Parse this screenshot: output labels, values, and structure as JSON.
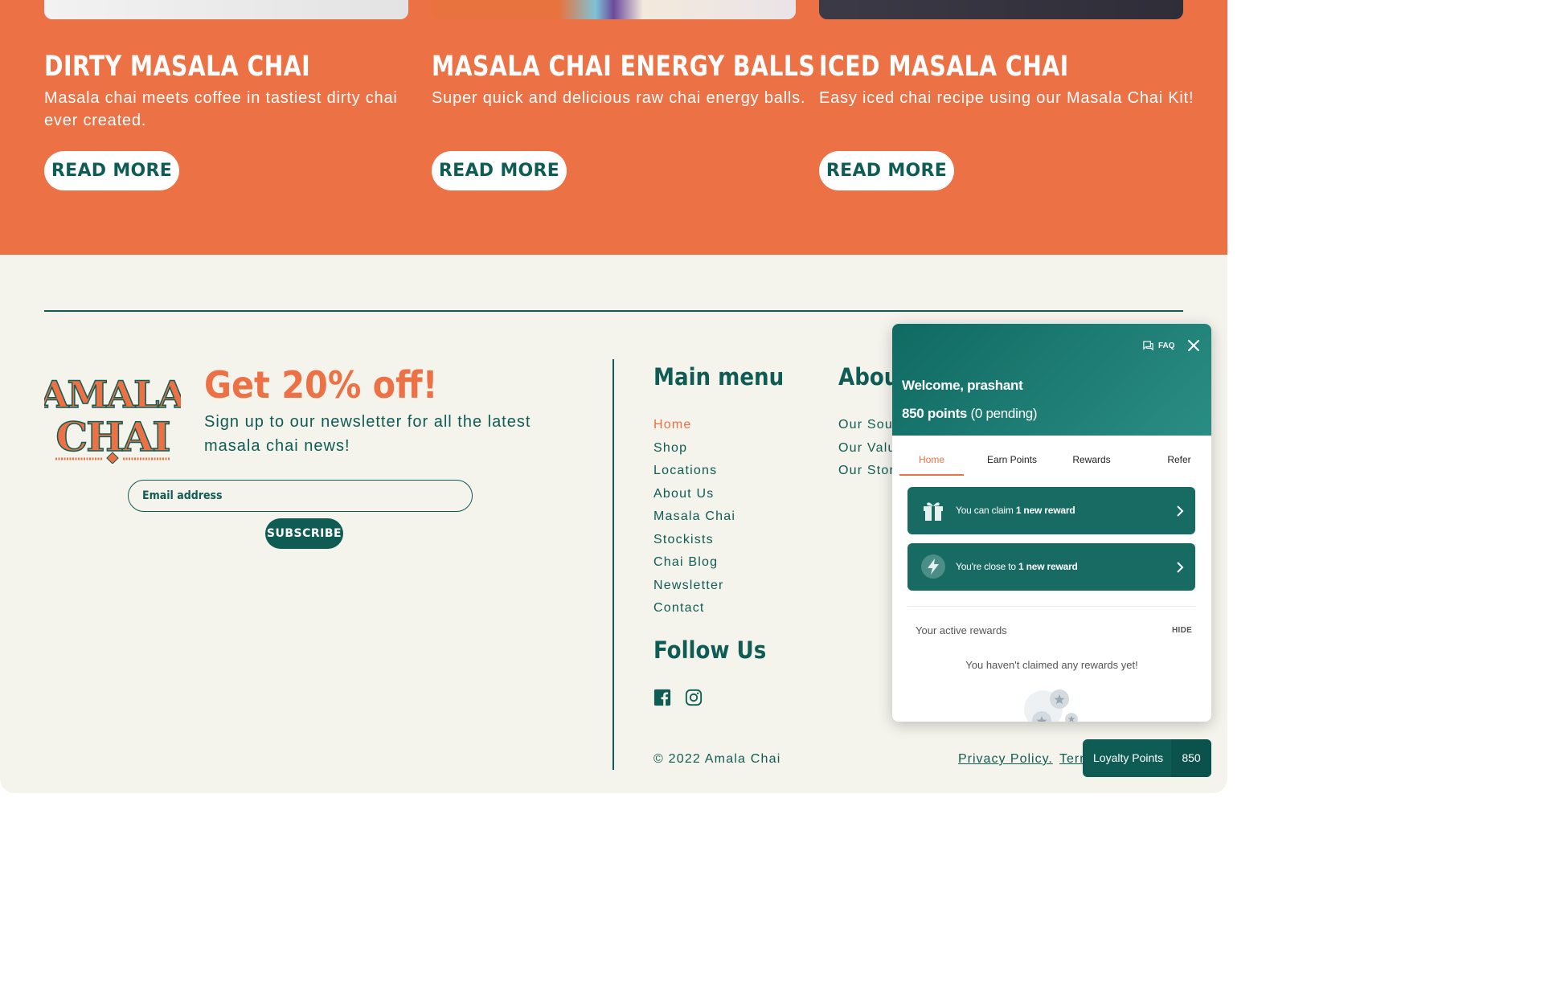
{
  "recipes": [
    {
      "title": "DIRTY MASALA CHAI",
      "description": "Masala chai meets coffee in tastiest dirty chai ever created.",
      "button": "READ MORE"
    },
    {
      "title": "MASALA CHAI ENERGY BALLS",
      "description": "Super quick and delicious raw chai energy balls.",
      "button": "READ MORE"
    },
    {
      "title": "ICED MASALA CHAI",
      "description": "Easy iced chai recipe using our Masala Chai Kit!",
      "button": "READ MORE"
    }
  ],
  "newsletter": {
    "logo_text": [
      "AMALA",
      "CHAI"
    ],
    "title": "Get 20% off!",
    "text": "Sign up to our newsletter for all the latest masala chai news!",
    "email_placeholder": "Email address",
    "subscribe_label": "SUBSCRIBE"
  },
  "main_menu": {
    "title": "Main menu",
    "items": [
      "Home",
      "Shop",
      "Locations",
      "About Us",
      "Masala Chai",
      "Stockists",
      "Chai Blog",
      "Newsletter",
      "Contact"
    ]
  },
  "about": {
    "title": "About",
    "items": [
      "Our Sour",
      "Our Valu",
      "Our Stor"
    ]
  },
  "follow": {
    "title": "Follow Us",
    "icons": [
      "facebook-icon",
      "instagram-icon"
    ]
  },
  "legal": {
    "copyright": "© 2022 Amala Chai",
    "privacy": "Privacy Policy.",
    "terms": "Terr"
  },
  "widget": {
    "faq_label": "FAQ",
    "welcome": "Welcome, prashant",
    "points_bold": "850 points",
    "points_pending": "(0 pending)",
    "tabs": [
      "Home",
      "Earn Points",
      "Rewards",
      "Refer"
    ],
    "cards": [
      {
        "prefix": "You can claim ",
        "bold": "1 new reward",
        "icon": "gift-icon"
      },
      {
        "prefix": "You're close to ",
        "bold": "1 new reward",
        "icon": "lightning-icon"
      }
    ],
    "active_rewards_label": "Your active rewards",
    "hide_label": "HIDE",
    "empty_message": "You haven't claimed any rewards yet!"
  },
  "loyalty_button": {
    "label": "Loyalty Points",
    "count": "850"
  },
  "colors": {
    "orange": "#ec7145",
    "teal": "#0f5c55",
    "cream": "#f4f3ec"
  }
}
